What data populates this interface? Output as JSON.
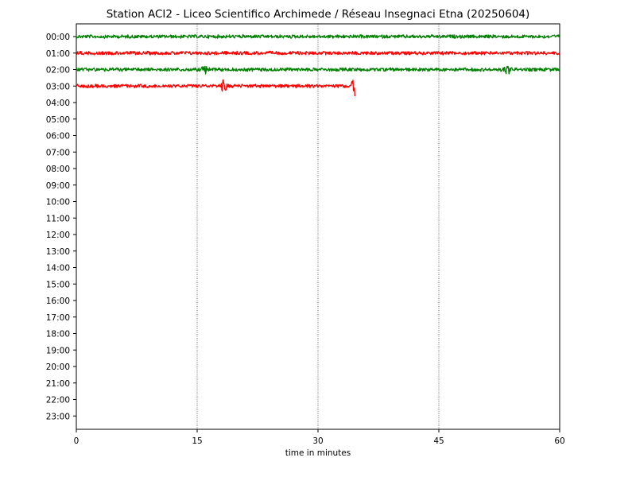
{
  "chart_data": {
    "type": "line",
    "title": "Station ACI2 -  Liceo Scientifico Archimede / Réseau Insegnaci Etna (20250604)",
    "xlabel": "time in minutes",
    "ylabel": "",
    "xlim": [
      0,
      60
    ],
    "x_ticks": [
      "0",
      "15",
      "30",
      "45",
      "60"
    ],
    "y_ticks": [
      "00:00",
      "01:00",
      "02:00",
      "03:00",
      "04:00",
      "05:00",
      "06:00",
      "07:00",
      "08:00",
      "09:00",
      "10:00",
      "11:00",
      "12:00",
      "13:00",
      "14:00",
      "15:00",
      "16:00",
      "17:00",
      "18:00",
      "19:00",
      "20:00",
      "21:00",
      "22:00",
      "23:00"
    ],
    "grid": "vertical dotted lines at 15, 30, 45 minutes",
    "series": [
      {
        "hour": "00:00",
        "start_min": 0,
        "end_min": 60,
        "color": "#008000",
        "events": []
      },
      {
        "hour": "01:00",
        "start_min": 0,
        "end_min": 60,
        "color": "#ff0000",
        "events": []
      },
      {
        "hour": "02:00",
        "start_min": 0,
        "end_min": 60,
        "color": "#008000",
        "events": [
          {
            "min": 16,
            "amp": 0.25
          },
          {
            "min": 53.5,
            "amp": 0.3
          }
        ]
      },
      {
        "hour": "03:00",
        "start_min": 0,
        "end_min": 34.6,
        "color": "#ff0000",
        "events": [
          {
            "min": 18.3,
            "amp": 0.35
          },
          {
            "min": 34.6,
            "amp": 0.6
          }
        ]
      }
    ]
  }
}
